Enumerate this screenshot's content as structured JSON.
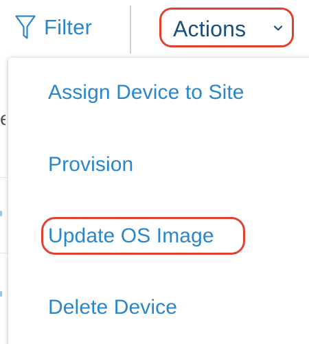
{
  "toolbar": {
    "filter_label": "Filter",
    "filter_icon": "filter-icon",
    "actions_label": "Actions",
    "actions_icon": "chevron-down-icon"
  },
  "actions_menu": {
    "items": [
      {
        "label": "Assign Device to Site",
        "highlighted": false
      },
      {
        "label": "Provision",
        "highlighted": false
      },
      {
        "label": "Update OS Image",
        "highlighted": true
      },
      {
        "label": "Delete Device",
        "highlighted": false
      }
    ]
  },
  "colors": {
    "link_blue": "#2a86c9",
    "actions_text": "#1b4f7c",
    "highlight_red": "#e0412f",
    "divider": "#cfcfcf"
  }
}
